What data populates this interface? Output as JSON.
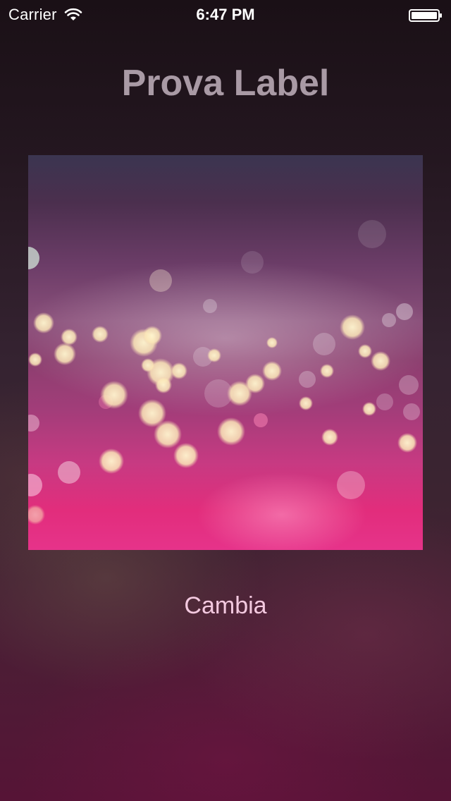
{
  "status_bar": {
    "carrier": "Carrier",
    "time": "6:47 PM",
    "wifi_icon": "wifi-icon",
    "battery_icon": "battery-icon"
  },
  "main": {
    "title": "Prova Label",
    "image_icon": "bokeh-photo",
    "button_label": "Cambia"
  },
  "colors": {
    "title": "#a99aa5",
    "button_text": "#f3c9df",
    "background_top": "#1a1016",
    "background_bottom": "#561436",
    "photo_top": "#3b3550",
    "photo_bottom": "#e6338a"
  }
}
